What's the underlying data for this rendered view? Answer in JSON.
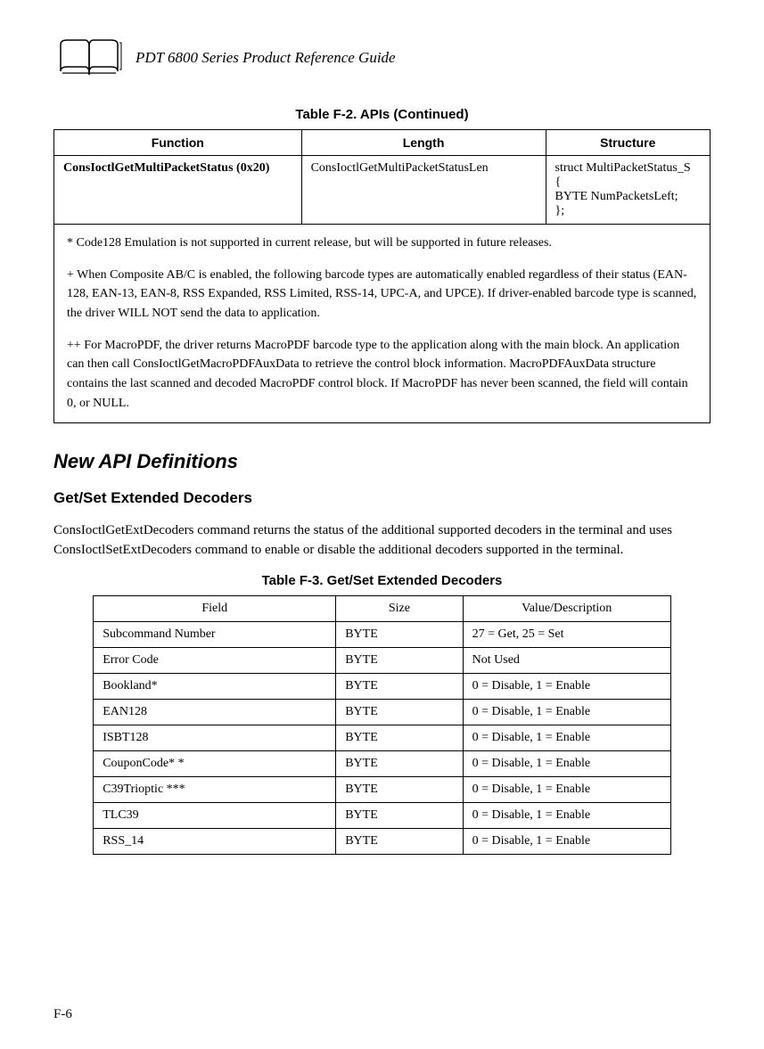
{
  "header": {
    "title": "PDT 6800 Series Product Reference Guide"
  },
  "table1": {
    "caption": "Table F-2. APIs (Continued)",
    "headers": {
      "function": "Function",
      "length": "Length",
      "structure": "Structure"
    },
    "row": {
      "function": "ConsIoctlGetMultiPacketStatus (0x20)",
      "length": "ConsIoctlGetMultiPacketStatusLen",
      "structure": "struct MultiPacketStatus_S\n{\nBYTE NumPacketsLeft;\n};"
    },
    "notes": {
      "n1": "*  Code128 Emulation is not supported in current release, but will be supported in future releases.",
      "n2": "+  When Composite AB/C is enabled, the following barcode types are automatically enabled regardless of their status (EAN-128, EAN-13, EAN-8, RSS Expanded, RSS Limited, RSS-14, UPC-A, and UPCE). If driver-enabled barcode type is scanned, the driver WILL NOT send the data to application.",
      "n3": "++ For MacroPDF, the driver returns MacroPDF barcode type to the application along with the main block.  An application can then call ConsIoctlGetMacroPDFAuxData to retrieve the control block information.  MacroPDFAuxData structure contains the last scanned and decoded MacroPDF control block. If MacroPDF has never been scanned, the field will contain 0, or NULL."
    }
  },
  "section": {
    "h2": "New API Definitions",
    "h3": "Get/Set Extended Decoders",
    "para": "ConsIoctlGetExtDecoders command returns the status of the additional supported decoders in the terminal and uses ConsIoctlSetExtDecoders command to enable or disable the additional decoders supported in the terminal."
  },
  "table2": {
    "caption": "Table F-3. Get/Set Extended Decoders",
    "headers": {
      "field": "Field",
      "size": "Size",
      "value": "Value/Description"
    },
    "rows": [
      {
        "field": "Subcommand Number",
        "size": "BYTE",
        "value": "27 = Get, 25 = Set"
      },
      {
        "field": "Error Code",
        "size": "BYTE",
        "value": "Not Used"
      },
      {
        "field": "Bookland*",
        "size": "BYTE",
        "value": "0 = Disable, 1 = Enable"
      },
      {
        "field": "EAN128",
        "size": "BYTE",
        "value": "0 = Disable, 1 = Enable"
      },
      {
        "field": "ISBT128",
        "size": "BYTE",
        "value": "0 = Disable, 1 = Enable"
      },
      {
        "field": "CouponCode* *",
        "size": "BYTE",
        "value": "0 = Disable, 1 = Enable"
      },
      {
        "field": "C39Trioptic ***",
        "size": "BYTE",
        "value": "0 = Disable, 1 = Enable"
      },
      {
        "field": "TLC39",
        "size": "BYTE",
        "value": "0 = Disable, 1 = Enable"
      },
      {
        "field": "RSS_14",
        "size": "BYTE",
        "value": "0 = Disable, 1 = Enable"
      }
    ]
  },
  "page_num": "F-6"
}
